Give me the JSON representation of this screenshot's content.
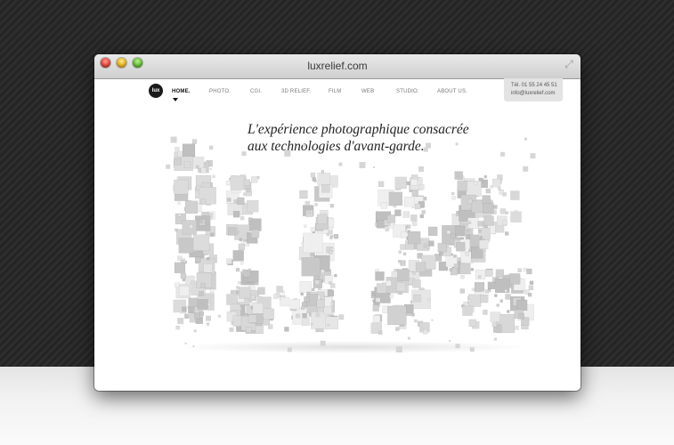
{
  "window": {
    "title": "luxrelief.com"
  },
  "site": {
    "logo_text": "lux",
    "nav": [
      {
        "label": "HOME.",
        "active": true
      },
      {
        "label": "PHOTO.",
        "active": false
      },
      {
        "label": "CGI.",
        "active": false
      },
      {
        "label": "3D RELIEF.",
        "active": false
      },
      {
        "label": "FILM",
        "active": false
      },
      {
        "label": "WEB",
        "active": false
      },
      {
        "label": "STUDIO.",
        "active": false
      },
      {
        "label": "ABOUT US.",
        "active": false
      }
    ],
    "contact": {
      "phone": "Tél. 01 55 24 45 51",
      "email": "info@luxrelief.com"
    },
    "tagline_line1": "L'expérience photographique consacrée",
    "tagline_line2": "aux technologies d'avant-garde.",
    "hero_word": "lux"
  },
  "colors": {
    "background": "#2a2a2a",
    "accent": "#1a1a1a",
    "cube": "#d9d9d9"
  },
  "icons": [
    "close-icon",
    "minimize-icon",
    "zoom-icon",
    "fullscreen-icon",
    "caret-down-icon"
  ]
}
